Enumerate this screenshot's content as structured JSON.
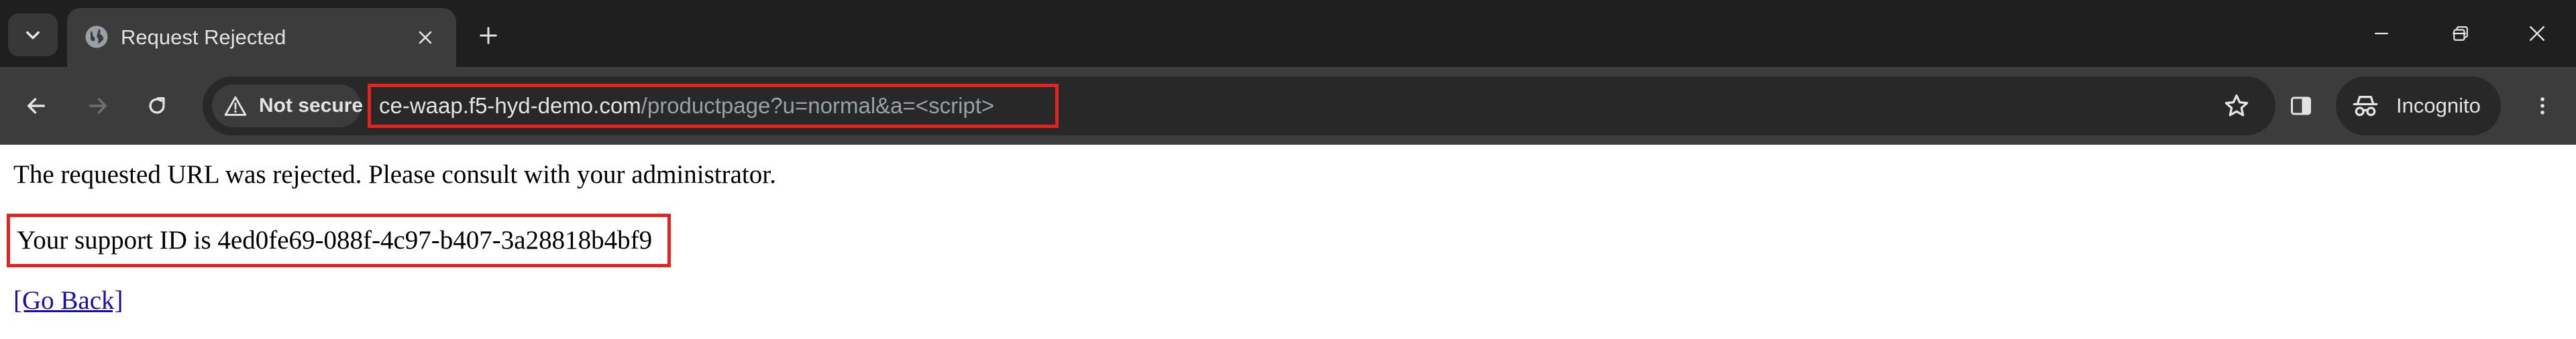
{
  "browser": {
    "tab": {
      "title": "Request Rejected"
    },
    "omnibox": {
      "security_label": "Not secure",
      "url_host": "ce-waap.f5-hyd-demo.com",
      "url_path": "/productpage?u=normal&a=<script>"
    },
    "profile_label": "Incognito"
  },
  "page": {
    "message": "The requested URL was rejected. Please consult with your administrator.",
    "support_id_text": "Your support ID is 4ed0fe69-088f-4c97-b407-3a28818b4bf9",
    "go_back": "[Go Back]"
  },
  "colors": {
    "highlight": "#e5231e",
    "link": "#1a0dab",
    "tabstrip_bg": "#1f1f1f",
    "toolbar_bg": "#3c3c3c"
  }
}
